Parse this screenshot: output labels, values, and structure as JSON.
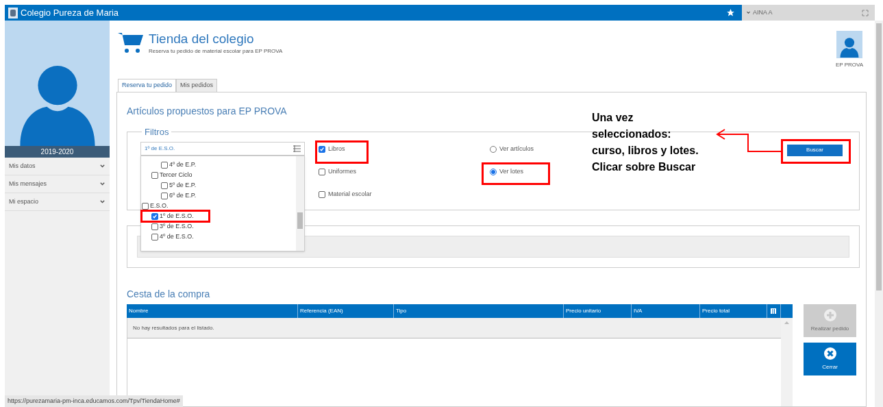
{
  "app": {
    "title": "Colegio Pureza de Maria",
    "user": "AINA A"
  },
  "sidebar": {
    "year": "2019-2020",
    "items": [
      {
        "label": "Mis datos"
      },
      {
        "label": "Mis mensajes"
      },
      {
        "label": "Mi espacio"
      }
    ]
  },
  "page": {
    "title": "Tienda del colegio",
    "subtitle": "Reserva tu pedido de material escolar para EP PROVA",
    "profile_name": "EP PROVA"
  },
  "tabs": [
    {
      "label": "Reserva tu pedido",
      "selected": true
    },
    {
      "label": "Mis pedidos",
      "selected": false
    }
  ],
  "section_title": "Artículos propuestos para EP PROVA",
  "filters": {
    "legend": "Filtros",
    "course_field": {
      "value": "1º de E.S.O."
    },
    "course_tree": [
      {
        "children": [
          {
            "children": [
              {
                "label": "4º de E.P.",
                "checked": false
              }
            ]
          },
          {
            "label": "Tercer Ciclo",
            "checked": false,
            "children": [
              {
                "label": "5º de E.P.",
                "checked": false
              },
              {
                "label": "6º de E.P.",
                "checked": false
              }
            ]
          }
        ]
      },
      {
        "label": "E.S.O.",
        "checked": false,
        "children": [
          {
            "label": "1º de E.S.O.",
            "checked": true
          },
          {
            "label": "3º de E.S.O.",
            "checked": false
          },
          {
            "label": "4º de E.S.O.",
            "checked": false
          }
        ]
      }
    ],
    "categories": [
      {
        "label": "Libros",
        "checked": true
      },
      {
        "label": "Uniformes",
        "checked": false
      },
      {
        "label": "Material escolar",
        "checked": false
      }
    ],
    "view_options": [
      {
        "label": "Ver artículos",
        "selected": false
      },
      {
        "label": "Ver lotes",
        "selected": true
      }
    ],
    "search_button": "Buscar"
  },
  "cart": {
    "title": "Cesta de la compra",
    "columns": [
      "Nombre",
      "Referencia (EAN)",
      "Tipo",
      "Precio unitario",
      "IVA",
      "Precio total"
    ],
    "empty_message": "No hay resultados para el listado."
  },
  "actions": [
    {
      "kind": "add",
      "label": "Realizar pedido",
      "disabled": true
    },
    {
      "kind": "close",
      "label": "Cerrar",
      "disabled": false
    }
  ],
  "status_bar": "https://purezamaria-pm-inca.educamos.com/Tpv/TiendaHome#",
  "annotation": {
    "lines": [
      "Una vez",
      "seleccionados:",
      "curso, libros y lotes.",
      "Clicar sobre Buscar"
    ]
  }
}
